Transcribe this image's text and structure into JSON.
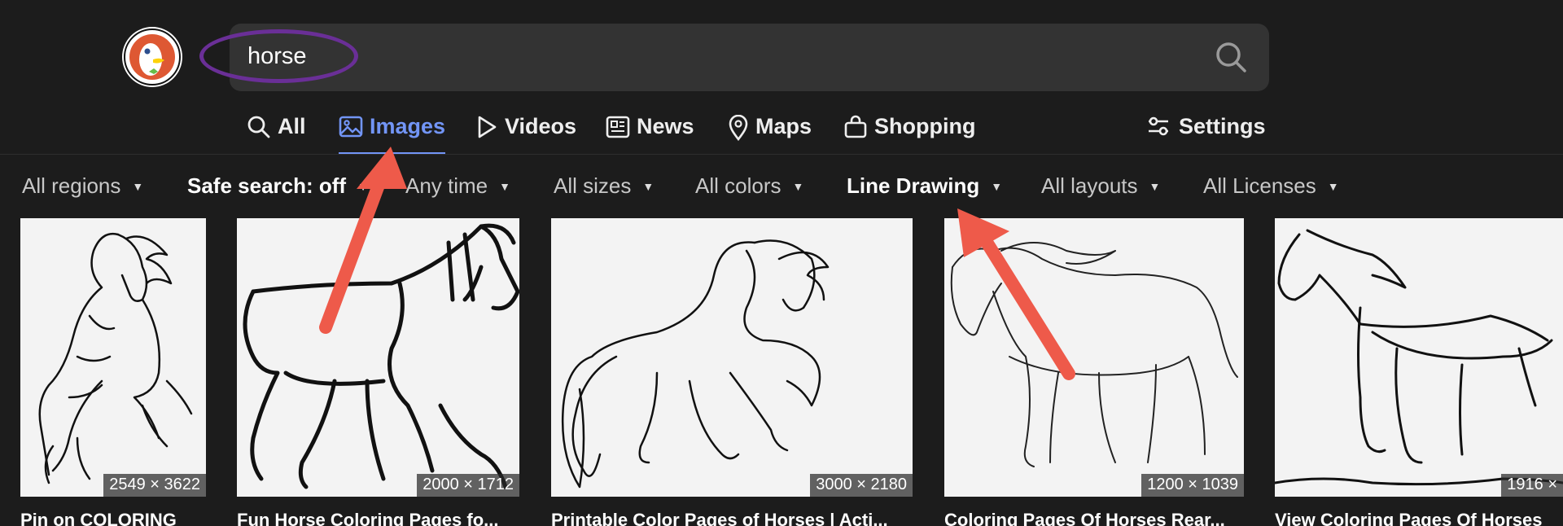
{
  "search": {
    "value": "horse"
  },
  "tabs": [
    {
      "label": "All",
      "icon": "search-icon"
    },
    {
      "label": "Images",
      "icon": "image-icon",
      "active": true
    },
    {
      "label": "Videos",
      "icon": "play-icon"
    },
    {
      "label": "News",
      "icon": "newspaper-icon"
    },
    {
      "label": "Maps",
      "icon": "map-pin-icon"
    },
    {
      "label": "Shopping",
      "icon": "shopping-bag-icon"
    }
  ],
  "settings": {
    "label": "Settings",
    "icon": "sliders-icon"
  },
  "filters": [
    {
      "label": "All regions"
    },
    {
      "label": "Safe search: off",
      "bold": true
    },
    {
      "label": "Any time"
    },
    {
      "label": "All sizes"
    },
    {
      "label": "All colors"
    },
    {
      "label": "Line Drawing",
      "bold": true
    },
    {
      "label": "All layouts"
    },
    {
      "label": "All Licenses"
    }
  ],
  "results": [
    {
      "dims": "2549 × 3622",
      "caption": "Pin on COLORING"
    },
    {
      "dims": "2000 × 1712",
      "caption": "Fun Horse Coloring Pages fo..."
    },
    {
      "dims": "3000 × 2180",
      "caption": "Printable Color Pages of Horses | Acti..."
    },
    {
      "dims": "1200 × 1039",
      "caption": "Coloring Pages Of Horses Rear..."
    },
    {
      "dims": "1916 ×",
      "caption": "View Coloring Pages Of Horses"
    }
  ],
  "colors": {
    "background": "#1c1c1c",
    "accent": "#7295f6",
    "annotation_arrow": "#ee5a4a",
    "annotation_ellipse": "#6a2f97"
  }
}
